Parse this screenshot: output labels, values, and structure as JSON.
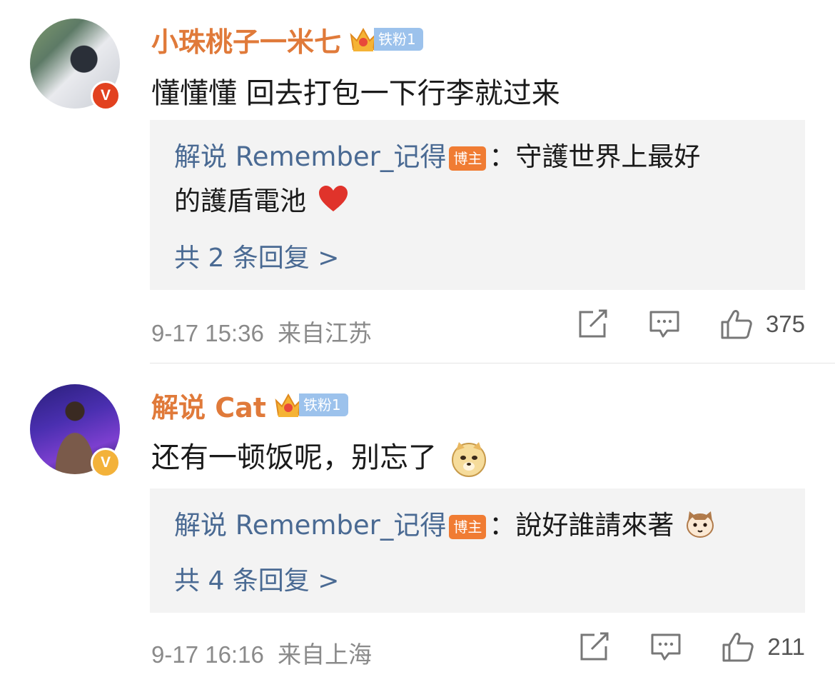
{
  "comments": [
    {
      "username": "小珠桃子一米七",
      "fan_badge": "铁粉1",
      "verified": "V",
      "text": "懂懂懂 回去打包一下行李就过来",
      "emoji": null,
      "reply": {
        "author": "解说 Remember_记得",
        "host_badge": "博主",
        "line1": "：守護世界上最好",
        "line2": "的護盾電池",
        "emoji": "heart-icon"
      },
      "more_replies": "共 2 条回复 >",
      "time": "9-17 15:36",
      "location": "来自江苏",
      "likes": "375"
    },
    {
      "username": "解说 Cat",
      "fan_badge": "铁粉1",
      "verified": "V",
      "text": "还有一顿饭呢，别忘了",
      "emoji": "doge-icon",
      "reply": {
        "author": "解说 Remember_记得",
        "host_badge": "博主",
        "line1": "：說好誰請來著",
        "line2": "",
        "emoji": "cat-icon"
      },
      "more_replies": "共 4 条回复 >",
      "time": "9-17 16:16",
      "location": "来自上海",
      "likes": "211"
    }
  ],
  "colors": {
    "username": "#e07a3a",
    "reply_author": "#4a6a93",
    "reply_bg": "#f3f3f3",
    "meta": "#8a8a8a",
    "fan_badge": "#9cc2ec",
    "host_badge": "#f07c33"
  }
}
